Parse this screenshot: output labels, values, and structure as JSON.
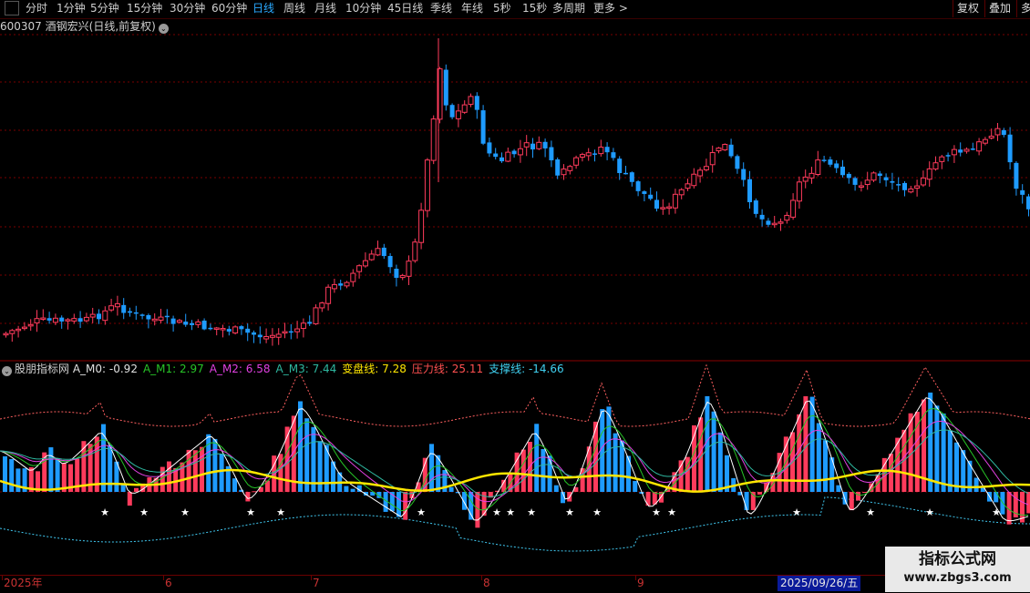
{
  "toolbar": {
    "periods": [
      {
        "label": "分时",
        "active": false
      },
      {
        "label": "1分钟",
        "active": false
      },
      {
        "label": "5分钟",
        "active": false
      },
      {
        "label": "15分钟",
        "active": false
      },
      {
        "label": "30分钟",
        "active": false
      },
      {
        "label": "60分钟",
        "active": false
      },
      {
        "label": "日线",
        "active": true
      },
      {
        "label": "周线",
        "active": false
      },
      {
        "label": "月线",
        "active": false
      },
      {
        "label": "10分钟",
        "active": false
      },
      {
        "label": "45日线",
        "active": false
      },
      {
        "label": "季线",
        "active": false
      },
      {
        "label": "年线",
        "active": false
      },
      {
        "label": "5秒",
        "active": false
      },
      {
        "label": "15秒",
        "active": false
      },
      {
        "label": "多周期",
        "active": false
      },
      {
        "label": "更多 >",
        "active": false
      }
    ],
    "right_buttons": [
      "复权",
      "叠加",
      "多"
    ]
  },
  "main_header": {
    "code": "600307",
    "name": "酒钢宏兴",
    "period_info": "(日线,前复权)"
  },
  "indicator_header": {
    "name": "股朋指标网",
    "items": [
      {
        "label": "A_M0:",
        "value": "-0.92",
        "color": "#e0e0e0"
      },
      {
        "label": "A_M1:",
        "value": "2.97",
        "color": "#27c427"
      },
      {
        "label": "A_M2:",
        "value": "6.58",
        "color": "#e040e0"
      },
      {
        "label": "A_M3:",
        "value": "7.44",
        "color": "#2eb8a0"
      },
      {
        "label": "变盘线:",
        "value": "7.28",
        "color": "#ffe600"
      },
      {
        "label": "压力线:",
        "value": "25.11",
        "color": "#ff5050"
      },
      {
        "label": "支撑线:",
        "value": "-14.66",
        "color": "#40d0f0"
      }
    ]
  },
  "date_axis": {
    "labels": [
      "2025年",
      "6",
      "7",
      "8",
      "9"
    ],
    "cursor_date": "2025/09/26/五"
  },
  "watermark": {
    "title": "指标公式网",
    "url": "www.zbgs3.com"
  },
  "colors": {
    "up": "#ff3b5c",
    "down": "#1e9bff",
    "grid": "#7a0000",
    "turning_line": "#ffe600",
    "pressure_line": "#ff6060",
    "support_line": "#40c8f0"
  },
  "star_symbol": "★"
}
